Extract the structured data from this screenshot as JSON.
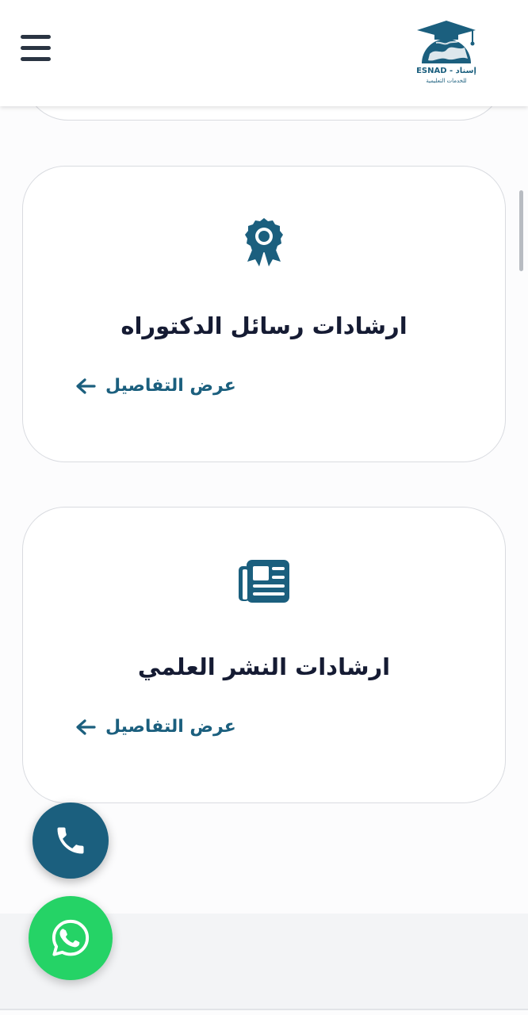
{
  "header": {
    "logo": {
      "latin_text": "ESNAD",
      "arabic_text": "إسناد",
      "tagline": "للخدمات التعليمية",
      "icon": "graduation-cap-globe-icon"
    },
    "menu_icon": "hamburger-menu-icon"
  },
  "cards": [
    {
      "icon": "award-badge-icon",
      "title": "ارشادات رسائل الدكتوراه",
      "link_label": "عرض التفاصيل",
      "link_icon": "arrow-left-icon"
    },
    {
      "icon": "newspaper-icon",
      "title": "ارشادات النشر العلمي",
      "link_label": "عرض التفاصيل",
      "link_icon": "arrow-left-icon"
    }
  ],
  "floating_buttons": {
    "phone_icon": "phone-icon",
    "whatsapp_icon": "whatsapp-icon"
  },
  "colors": {
    "brand": "#1b5f7e",
    "title_text": "#151b33",
    "whatsapp": "#25d366",
    "card_border": "#d9dbe0"
  }
}
